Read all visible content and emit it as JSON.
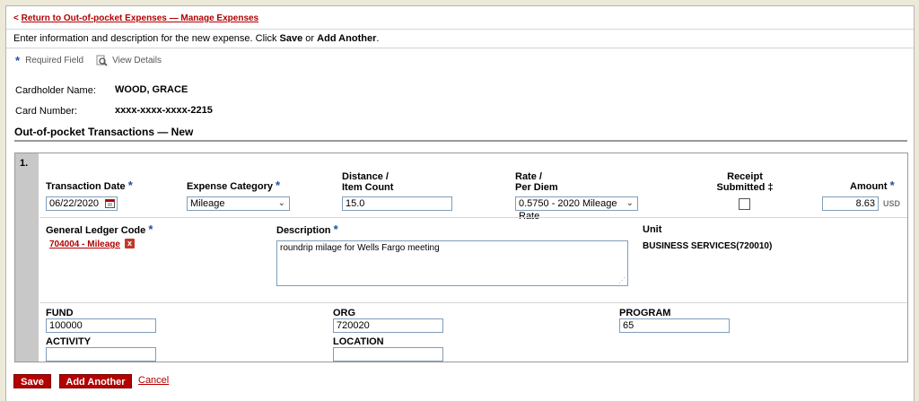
{
  "nav": {
    "back_arrow": "<",
    "back_link": "Return to Out-of-pocket Expenses — Manage Expenses"
  },
  "intro": {
    "text_before": "Enter information and description for the new expense. Click ",
    "save": "Save",
    "or": " or ",
    "add_another": "Add Another",
    "end": "."
  },
  "legend": {
    "required_star": "*",
    "required_label": "Required Field",
    "view_details": "View Details"
  },
  "cardholder": {
    "name_label": "Cardholder Name:",
    "name_value": "WOOD, GRACE",
    "card_label": "Card Number:",
    "card_value": "xxxx-xxxx-xxxx-2215"
  },
  "section_title": "Out-of-pocket Transactions — New",
  "transaction": {
    "number": "1.",
    "date_label": "Transaction Date",
    "date_value": "06/22/2020",
    "category_label": "Expense Category",
    "category_value": "Mileage",
    "distance_label_1": "Distance /",
    "distance_label_2": "Item Count",
    "distance_value": "15.0",
    "rate_label_1": "Rate /",
    "rate_label_2": "Per Diem",
    "rate_value": "0.5750 - 2020 Mileage Rate",
    "receipt_label_1": "Receipt",
    "receipt_label_2": "Submitted ‡",
    "amount_label": "Amount",
    "amount_value": "8.63",
    "currency": "USD",
    "gl_label": "General Ledger Code",
    "gl_value": "704004 - Mileage",
    "gl_remove": "x",
    "description_label": "Description",
    "description_value": "roundrip milage for Wells Fargo meeting",
    "unit_label": "Unit",
    "unit_value": "BUSINESS SERVICES(720010)",
    "fund_label": "FUND",
    "fund_value": "100000",
    "org_label": "ORG",
    "org_value": "720020",
    "program_label": "PROGRAM",
    "program_value": "65",
    "activity_label": "ACTIVITY",
    "activity_value": "",
    "location_label": "LOCATION",
    "location_value": ""
  },
  "actions": {
    "save": "Save",
    "add_another": "Add Another",
    "cancel": "Cancel"
  },
  "colors": {
    "brand_red": "#b30000",
    "required_star": "#1f4fa8"
  }
}
